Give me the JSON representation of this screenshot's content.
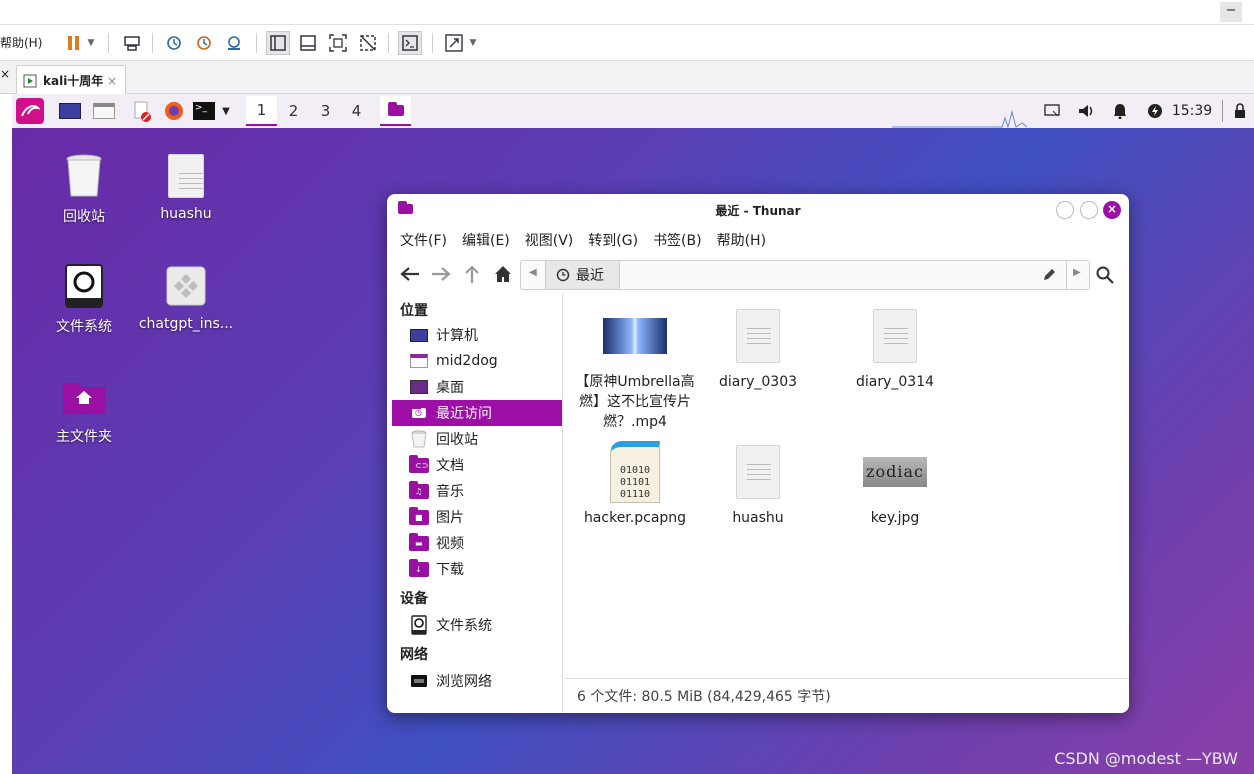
{
  "vmware": {
    "menu_help": "帮助(H)",
    "tab_title": "kali十周年",
    "tab_close": "×",
    "minimize": "−"
  },
  "panel": {
    "workspaces": [
      "1",
      "2",
      "3",
      "4"
    ],
    "clock": "15:39"
  },
  "desktop": {
    "icons": [
      {
        "label": "回收站",
        "icon": "trash-icon"
      },
      {
        "label": "huashu",
        "icon": "text-file-icon"
      },
      {
        "label": "文件系统",
        "icon": "drive-icon"
      },
      {
        "label": "chatgpt_ins...",
        "icon": "package-icon"
      },
      {
        "label": "主文件夹",
        "icon": "home-folder-icon"
      }
    ],
    "watermark": "CSDN @modest —YBW"
  },
  "thunar": {
    "title": "最近 - Thunar",
    "menu": [
      "文件(F)",
      "编辑(E)",
      "视图(V)",
      "转到(G)",
      "书签(B)",
      "帮助(H)"
    ],
    "location": "最近",
    "sidebar": {
      "places_header": "位置",
      "places": [
        "计算机",
        "mid2dog",
        "桌面",
        "最近访问",
        "回收站",
        "文档",
        "音乐",
        "图片",
        "视频",
        "下载"
      ],
      "devices_header": "设备",
      "devices": [
        "文件系统"
      ],
      "network_header": "网络",
      "network": [
        "浏览网络"
      ]
    },
    "files": [
      {
        "name_lines": [
          "【原神Umbrella高",
          "燃】这不比宣传片",
          "燃？.mp4"
        ],
        "kind": "video"
      },
      {
        "name_lines": [
          "diary_0303"
        ],
        "kind": "text"
      },
      {
        "name_lines": [
          "diary_0314"
        ],
        "kind": "text"
      },
      {
        "name_lines": [
          "hacker.pcapng"
        ],
        "kind": "binary"
      },
      {
        "name_lines": [
          "huashu"
        ],
        "kind": "text"
      },
      {
        "name_lines": [
          "key.jpg"
        ],
        "kind": "image"
      }
    ],
    "binary_glyph": [
      "01010",
      "01101",
      "01110"
    ],
    "key_image_text": "zodiac",
    "status": "6 个文件: 80.5 MiB (84,429,465 字节)"
  },
  "colors": {
    "accent": "#9c0ea6",
    "desktop_start": "#6a2aa6",
    "desktop_end": "#3f4fc0"
  }
}
